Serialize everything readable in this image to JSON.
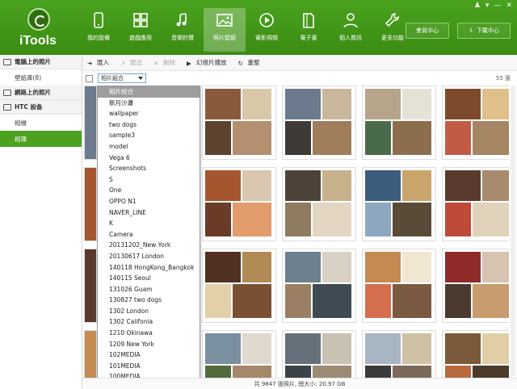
{
  "app": {
    "name": "iTools"
  },
  "window_controls": [
    "♟",
    "▾",
    "—",
    "✕"
  ],
  "nav": [
    {
      "label": "我的設備",
      "icon": "phone-icon"
    },
    {
      "label": "遊戲應用",
      "icon": "apps-icon"
    },
    {
      "label": "音樂鈴聲",
      "icon": "music-icon"
    },
    {
      "label": "照片壁紙",
      "icon": "photo-icon",
      "active": true
    },
    {
      "label": "電影視頻",
      "icon": "play-icon"
    },
    {
      "label": "電子書",
      "icon": "book-icon"
    },
    {
      "label": "個人資訊",
      "icon": "person-icon"
    },
    {
      "label": "更多功能",
      "icon": "wrench-icon"
    }
  ],
  "header_buttons": {
    "member": "會員中心",
    "download": "下載中心"
  },
  "sidebar": {
    "sections": [
      {
        "title": "電腦上的照片",
        "items": [
          {
            "label": "壁紙庫(8)"
          }
        ]
      },
      {
        "title": "網路上的照片",
        "items": []
      },
      {
        "title": "HTC 設备",
        "items": [
          {
            "label": "相機"
          },
          {
            "label": "相簿",
            "active": true
          }
        ]
      }
    ]
  },
  "toolbar": {
    "import": "匯入",
    "export": "匯出",
    "delete": "刪除",
    "slideshow": "幻燈片播放",
    "refresh": "重整"
  },
  "filter": {
    "selected": "相片組合",
    "count": "55 張"
  },
  "dropdown": [
    "相片組合",
    "新月沙灘",
    "wallpaper",
    "two dogs",
    "sample3",
    "model",
    "Vega 6",
    "Screenshots",
    "S",
    "One",
    "OPPO N1",
    "NAVER_LINE",
    "K",
    "Camera",
    "20131202_New York",
    "20130617 London",
    "140118 HongKong_Bangkok",
    "140115 Seoul",
    "131026 Guam",
    "130827 two dogs",
    "1302 London",
    "1302 Califonia",
    "1210 Okinawa",
    "1209 New York",
    "102MEDIA",
    "101MEDIA",
    "100MEDIA"
  ],
  "status": "共 9847 張照片, 總大小: 20.97 GB",
  "colors": {
    "accent": "#4aa21e",
    "accent_dark": "#3a8c12"
  }
}
